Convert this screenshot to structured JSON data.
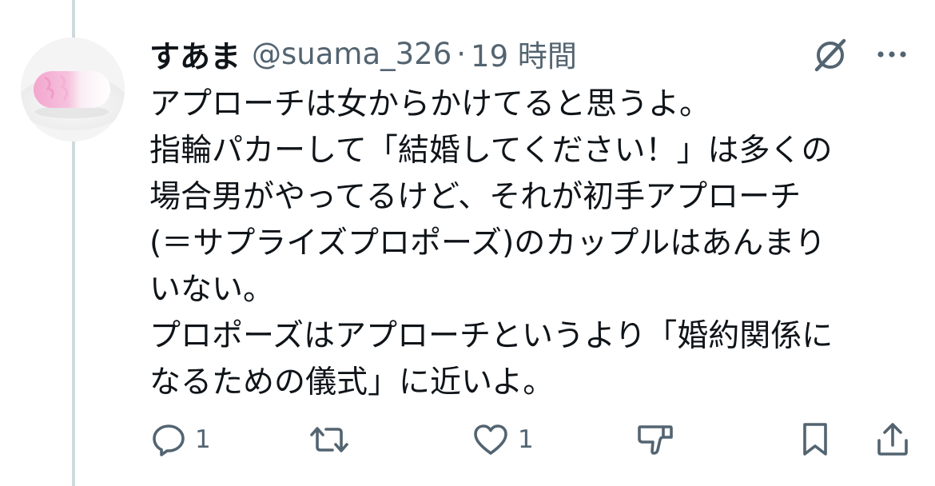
{
  "tweet": {
    "display_name": "すあま",
    "handle": "@suama_326",
    "separator": "·",
    "timestamp": "19 時間",
    "text_lines": [
      "アプローチは女からかけてると思うよ。",
      "指輪パカーして「結婚してください！」は多くの",
      "場合男がやってるけど、それが初手アプローチ",
      "(＝サプライズプロポーズ)のカップルはあんまり",
      "いない。",
      "プロポーズはアプローチというより「婚約関係に",
      "なるための儀式」に近いよ。"
    ]
  },
  "icons": {
    "grok": "grok-icon",
    "more": "more-dots-icon",
    "reply": "reply-icon",
    "retweet": "retweet-icon",
    "like": "heart-icon",
    "downvote": "downvote-icon",
    "bookmark": "bookmark-icon",
    "share": "share-icon"
  },
  "actions": {
    "reply_count": "1",
    "retweet_count": "",
    "like_count": "1"
  },
  "colors": {
    "text": "#0f1419",
    "secondary": "#536471",
    "thread_line": "#cfd9de",
    "background": "#ffffff"
  }
}
